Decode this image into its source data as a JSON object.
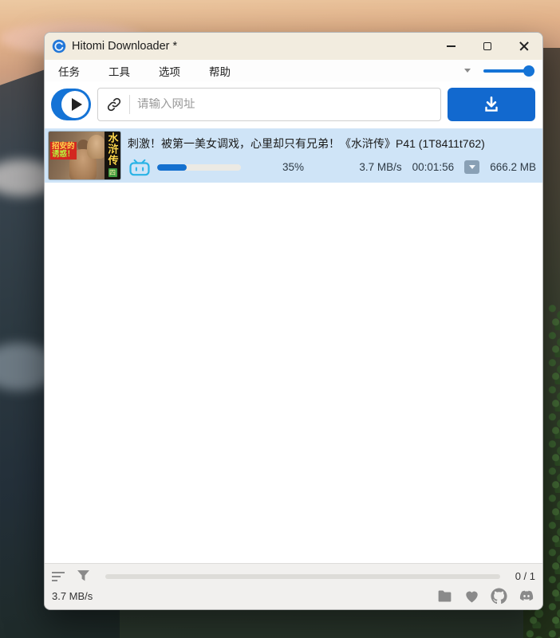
{
  "window": {
    "title": "Hitomi Downloader *"
  },
  "menu": {
    "items": [
      {
        "label": "任务"
      },
      {
        "label": "工具"
      },
      {
        "label": "选项"
      },
      {
        "label": "帮助"
      }
    ]
  },
  "toolbar": {
    "url_placeholder": "请输入网址"
  },
  "download_item": {
    "title": "刺激！被第一美女调戏，心里却只有兄弟！《水浒传》P41 (1T8411t762)",
    "progress_value": 35,
    "progress_label": "35%",
    "speed": "3.7 MB/s",
    "elapsed": "00:01:56",
    "size": "666.2 MB",
    "source": "bilibili",
    "thumbnail": {
      "tag_line1": "招安的",
      "tag_line2": "诱惑！",
      "side_title": "水浒传",
      "side_badge": "四"
    }
  },
  "statusbar": {
    "counter": "0 / 1",
    "speed": "3.7 MB/s"
  },
  "colors": {
    "accent": "#1473d6",
    "button_blue": "#1269cf",
    "selected_row": "#cfe4f7",
    "bilibili_blue": "#29b3e6",
    "titlebar": "#f2ecdf"
  }
}
